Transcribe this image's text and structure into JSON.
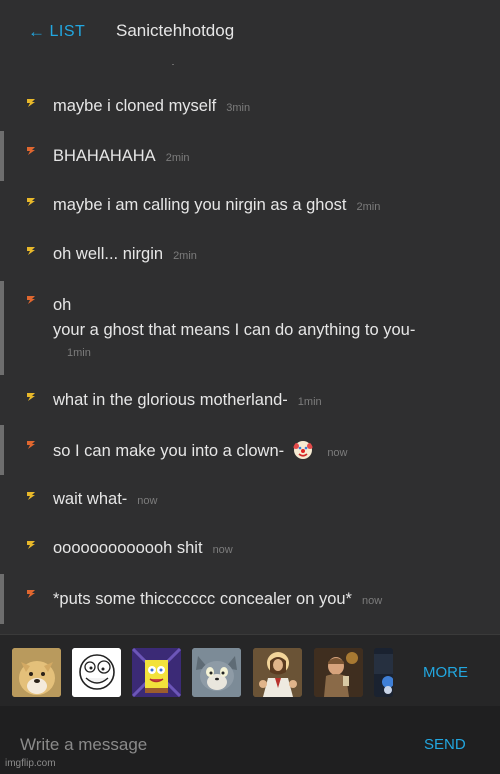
{
  "header": {
    "back_label": "LIST",
    "title": "Sanictehhotdog"
  },
  "messages": [
    {
      "sender": "self",
      "text": "maybe i cloned myself",
      "time": "3min"
    },
    {
      "sender": "other",
      "text": "BHAHAHAHA",
      "time": "2min"
    },
    {
      "sender": "self",
      "text": "maybe i am calling you nirgin as a ghost",
      "time": "2min"
    },
    {
      "sender": "self",
      "text": "oh well... nirgin",
      "time": "2min"
    },
    {
      "sender": "other",
      "line1": "oh",
      "line2": "your a ghost that means I can do anything to you-",
      "time": "1min"
    },
    {
      "sender": "self",
      "text": "what in the glorious motherland-",
      "time": "1min"
    },
    {
      "sender": "other",
      "text": "so I can make you into a clown-",
      "emoji": "clown-face",
      "time": "now"
    },
    {
      "sender": "self",
      "text": "wait what-",
      "time": "now"
    },
    {
      "sender": "self",
      "text": "ooooooooooooh shit",
      "time": "now"
    },
    {
      "sender": "other",
      "text": "*puts some thiccccccc concealer on you*",
      "time": "now"
    }
  ],
  "stickers": [
    "doge",
    "derp-face",
    "imagination-spongebob",
    "unsettled-tom",
    "buddy-christ",
    "leonardo-laughing",
    "partial-sticker"
  ],
  "sticker_bar": {
    "more_label": "MORE"
  },
  "composer": {
    "placeholder": "Write a message",
    "send_label": "SEND"
  },
  "watermark": "imgflip.com",
  "colors": {
    "accent": "#22a7e0",
    "background": "#2f2f30",
    "self_bolt": "#e8b82a",
    "other_bolt": "#e0672f"
  }
}
